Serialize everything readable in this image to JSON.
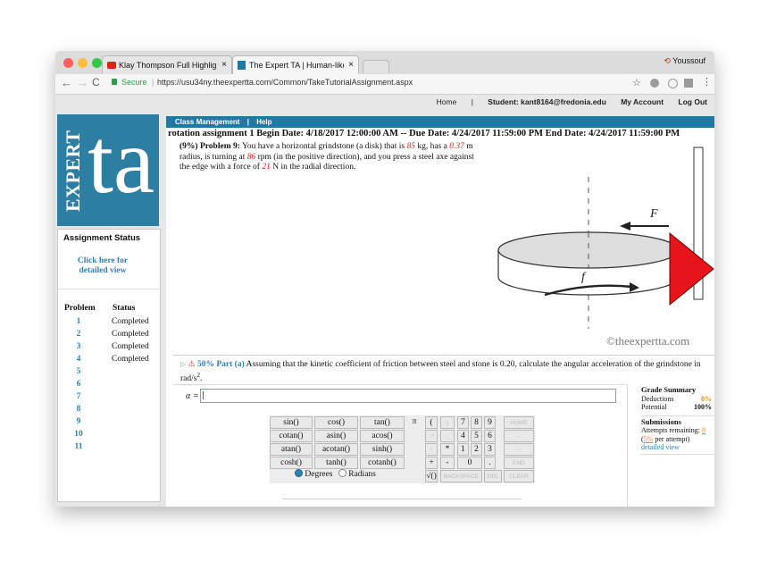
{
  "browser": {
    "tabs": [
      {
        "label": "Klay Thompson Full Highlight",
        "close": "×"
      },
      {
        "label": "The Expert TA | Human-like G",
        "close": "×"
      }
    ],
    "profile_name": "Youssouf",
    "secure_label": "Secure",
    "url": "https://usu34ny.theexpertta.com/Common/TakeTutorialAssignment.aspx"
  },
  "topnav": {
    "home": "Home",
    "separator": "|",
    "student": "Student: kant8164@fredonia.edu",
    "my_account": "My Account",
    "logout": "Log Out"
  },
  "logo": {
    "text_top": "EXPERT",
    "text_big": "ta"
  },
  "sidebar": {
    "title": "Assignment Status",
    "detail_link": "Click here for detailed view",
    "col_problem": "Problem",
    "col_status": "Status",
    "rows": [
      {
        "num": "1",
        "status": "Completed"
      },
      {
        "num": "2",
        "status": "Completed"
      },
      {
        "num": "3",
        "status": "Completed"
      },
      {
        "num": "4",
        "status": "Completed"
      },
      {
        "num": "5",
        "status": ""
      },
      {
        "num": "6",
        "status": ""
      },
      {
        "num": "7",
        "status": ""
      },
      {
        "num": "8",
        "status": ""
      },
      {
        "num": "9",
        "status": ""
      },
      {
        "num": "10",
        "status": ""
      },
      {
        "num": "11",
        "status": ""
      }
    ]
  },
  "menu": {
    "class_management": "Class Management",
    "separator": "|",
    "help": "Help"
  },
  "assignment": {
    "header": "rotation assignment 1 Begin Date: 4/18/2017 12:00:00 AM -- Due Date: 4/24/2017 11:59:00 PM End Date: 4/24/2017 11:59:00 PM"
  },
  "problem": {
    "label": "(9%) Problem 9:",
    "text1": "You have a horizontal grindstone (a disk) that is",
    "mass": "85",
    "text2": "kg, has a",
    "radius": "0.37",
    "text3": "m radius, is turning at",
    "rpm": "86",
    "text4": "rpm (in the positive direction), and you press a steel axe against the edge with a force of",
    "force": "21",
    "text5": "N in the radial direction."
  },
  "figure": {
    "label_F": "F",
    "label_f": "f",
    "watermark": "©theexpertta.com"
  },
  "part": {
    "percent": "50% Part (a)",
    "text": "Assuming that the kinetic coefficient of friction between steel and stone is 0.20, calculate the angular acceleration of the grindstone in rad/s",
    "exponent": "2",
    "period": ".",
    "input_label": "α =",
    "input_value": ""
  },
  "grade": {
    "title": "Grade Summary",
    "deductions_label": "Deductions",
    "deductions_value": "0%",
    "potential_label": "Potential",
    "potential_value": "100%",
    "submissions_title": "Submissions",
    "attempts_label": "Attempts remaining:",
    "attempts_value": "8",
    "per_attempt_value": "5%",
    "per_attempt_label": "per attempt)",
    "detailed_view": "detailed view"
  },
  "keypad": {
    "funcs": [
      [
        "sin()",
        "cos()",
        "tan()"
      ],
      [
        "cotan()",
        "asin()",
        "acos()"
      ],
      [
        "atan()",
        "acotan()",
        "sinh()"
      ],
      [
        "cosh()",
        "tanh()",
        "cotanh()"
      ]
    ],
    "degrees": "Degrees",
    "radians": "Radians",
    "pi": "π",
    "open_paren": "(",
    "close_paren": ")",
    "sqrt": "√()",
    "digits": [
      "7",
      "8",
      "9",
      "4",
      "5",
      "6",
      "1",
      "2",
      "3",
      "0"
    ],
    "ops": [
      "+",
      "-",
      "*",
      "/",
      "."
    ],
    "up": "↑^",
    "down": "↓_",
    "home": "HOME",
    "backarrow": "←",
    "fwdarrow": "→",
    "end": "END",
    "backspace": "BACKSPACE",
    "del": "DEL",
    "clear": "CLEAR"
  },
  "colors": {
    "accent_blue": "#1d7aa4",
    "value_red": "#e2231a",
    "link_blue": "#2b83b5",
    "deduction_orange": "#f08a00"
  }
}
